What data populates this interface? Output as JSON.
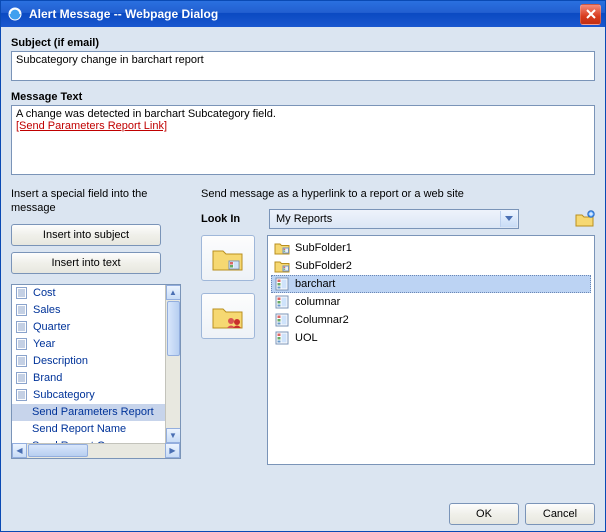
{
  "window": {
    "title": "Alert Message -- Webpage Dialog"
  },
  "labels": {
    "subject": "Subject (if email)",
    "message": "Message Text",
    "insert_help": "Insert a special field into the message",
    "hyperlink_help": "Send message as a hyperlink to a report or a web site",
    "look_in": "Look In"
  },
  "values": {
    "subject": "Subcategory change in barchart report",
    "message_line": "A change was detected in barchart Subcategory field.",
    "param_link_text": "[Send Parameters Report Link]",
    "lookin_selected": "My Reports"
  },
  "buttons": {
    "insert_subject": "Insert into subject",
    "insert_text": "Insert into text",
    "ok": "OK",
    "cancel": "Cancel"
  },
  "fields": [
    {
      "label": "Cost",
      "sub": false,
      "selected": false
    },
    {
      "label": "Sales",
      "sub": false,
      "selected": false
    },
    {
      "label": "Quarter",
      "sub": false,
      "selected": false
    },
    {
      "label": "Year",
      "sub": false,
      "selected": false
    },
    {
      "label": "Description",
      "sub": false,
      "selected": false
    },
    {
      "label": "Brand",
      "sub": false,
      "selected": false
    },
    {
      "label": "Subcategory",
      "sub": false,
      "selected": false
    },
    {
      "label": "Send Parameters Report",
      "sub": true,
      "selected": true
    },
    {
      "label": "Send Report Name",
      "sub": true,
      "selected": false
    },
    {
      "label": "Send Report Owner",
      "sub": true,
      "selected": false
    }
  ],
  "files": [
    {
      "label": "SubFolder1",
      "kind": "folder",
      "selected": false
    },
    {
      "label": "SubFolder2",
      "kind": "folder",
      "selected": false
    },
    {
      "label": "barchart",
      "kind": "report",
      "selected": true
    },
    {
      "label": "columnar",
      "kind": "report",
      "selected": false
    },
    {
      "label": "Columnar2",
      "kind": "report",
      "selected": false
    },
    {
      "label": "UOL",
      "kind": "report",
      "selected": false
    }
  ]
}
